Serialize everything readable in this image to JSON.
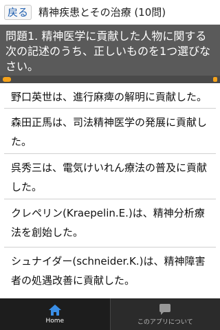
{
  "header": {
    "back_label": "戻る",
    "title": "精神疾患とその治療 (10問)"
  },
  "question": {
    "text": "問題1. 精神医学に貢献した人物に関する次の記述のうち、正しいものを1つ選びなさい。"
  },
  "options": [
    "野口英世は、進行麻痺の解明に貢献した。",
    "森田正馬は、司法精神医学の発展に貢献した。",
    "呉秀三は、電気けいれん療法の普及に貢献した。",
    "クレペリン(Kraepelin.E.)は、精神分析療法を創始した。",
    "シュナイダー(schneider.K.)は、精神障害者の処遇改善に貢献した。"
  ],
  "bottom_nav": {
    "home_label": "Home",
    "about_label": "このアプリについて"
  },
  "colors": {
    "accent": "#f5a21a",
    "question_bg": "#5a5a5a",
    "nav_bg": "#2b2b2b"
  }
}
